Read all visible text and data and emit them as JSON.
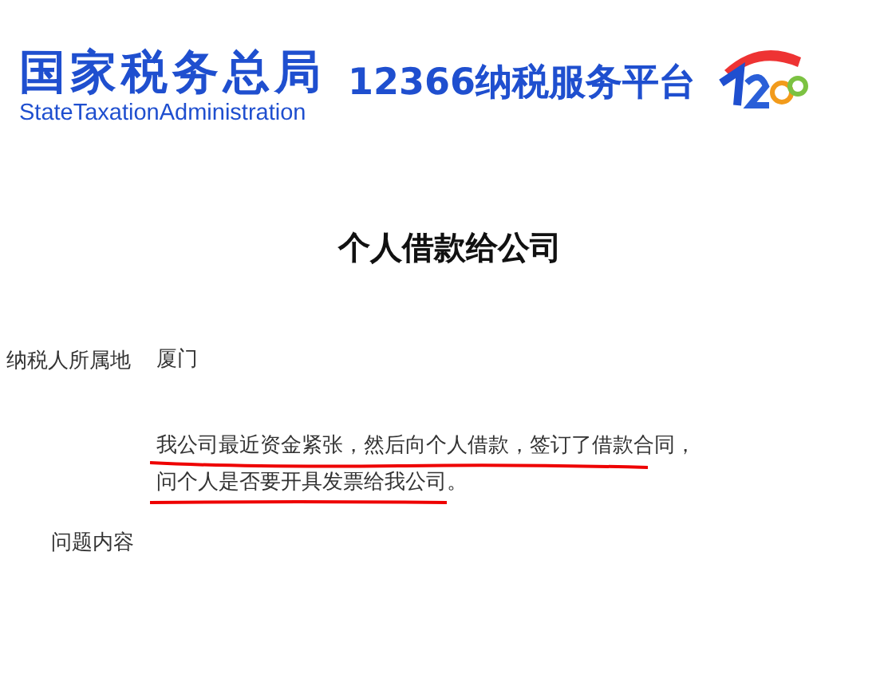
{
  "header": {
    "agency_name": "国家税务总局",
    "agency_name_en": "StateTaxationAdministration",
    "platform_name": "12366纳税服务平台"
  },
  "title": "个人借款给公司",
  "fields": [
    {
      "label": "纳税人所属地",
      "value": [
        "厦门"
      ]
    },
    {
      "label": "问题内容",
      "value": [
        "我公司最近资金紧张，然后向个人借款，签订了借款合同，",
        "问个人是否要开具发票给我公司。"
      ]
    }
  ]
}
